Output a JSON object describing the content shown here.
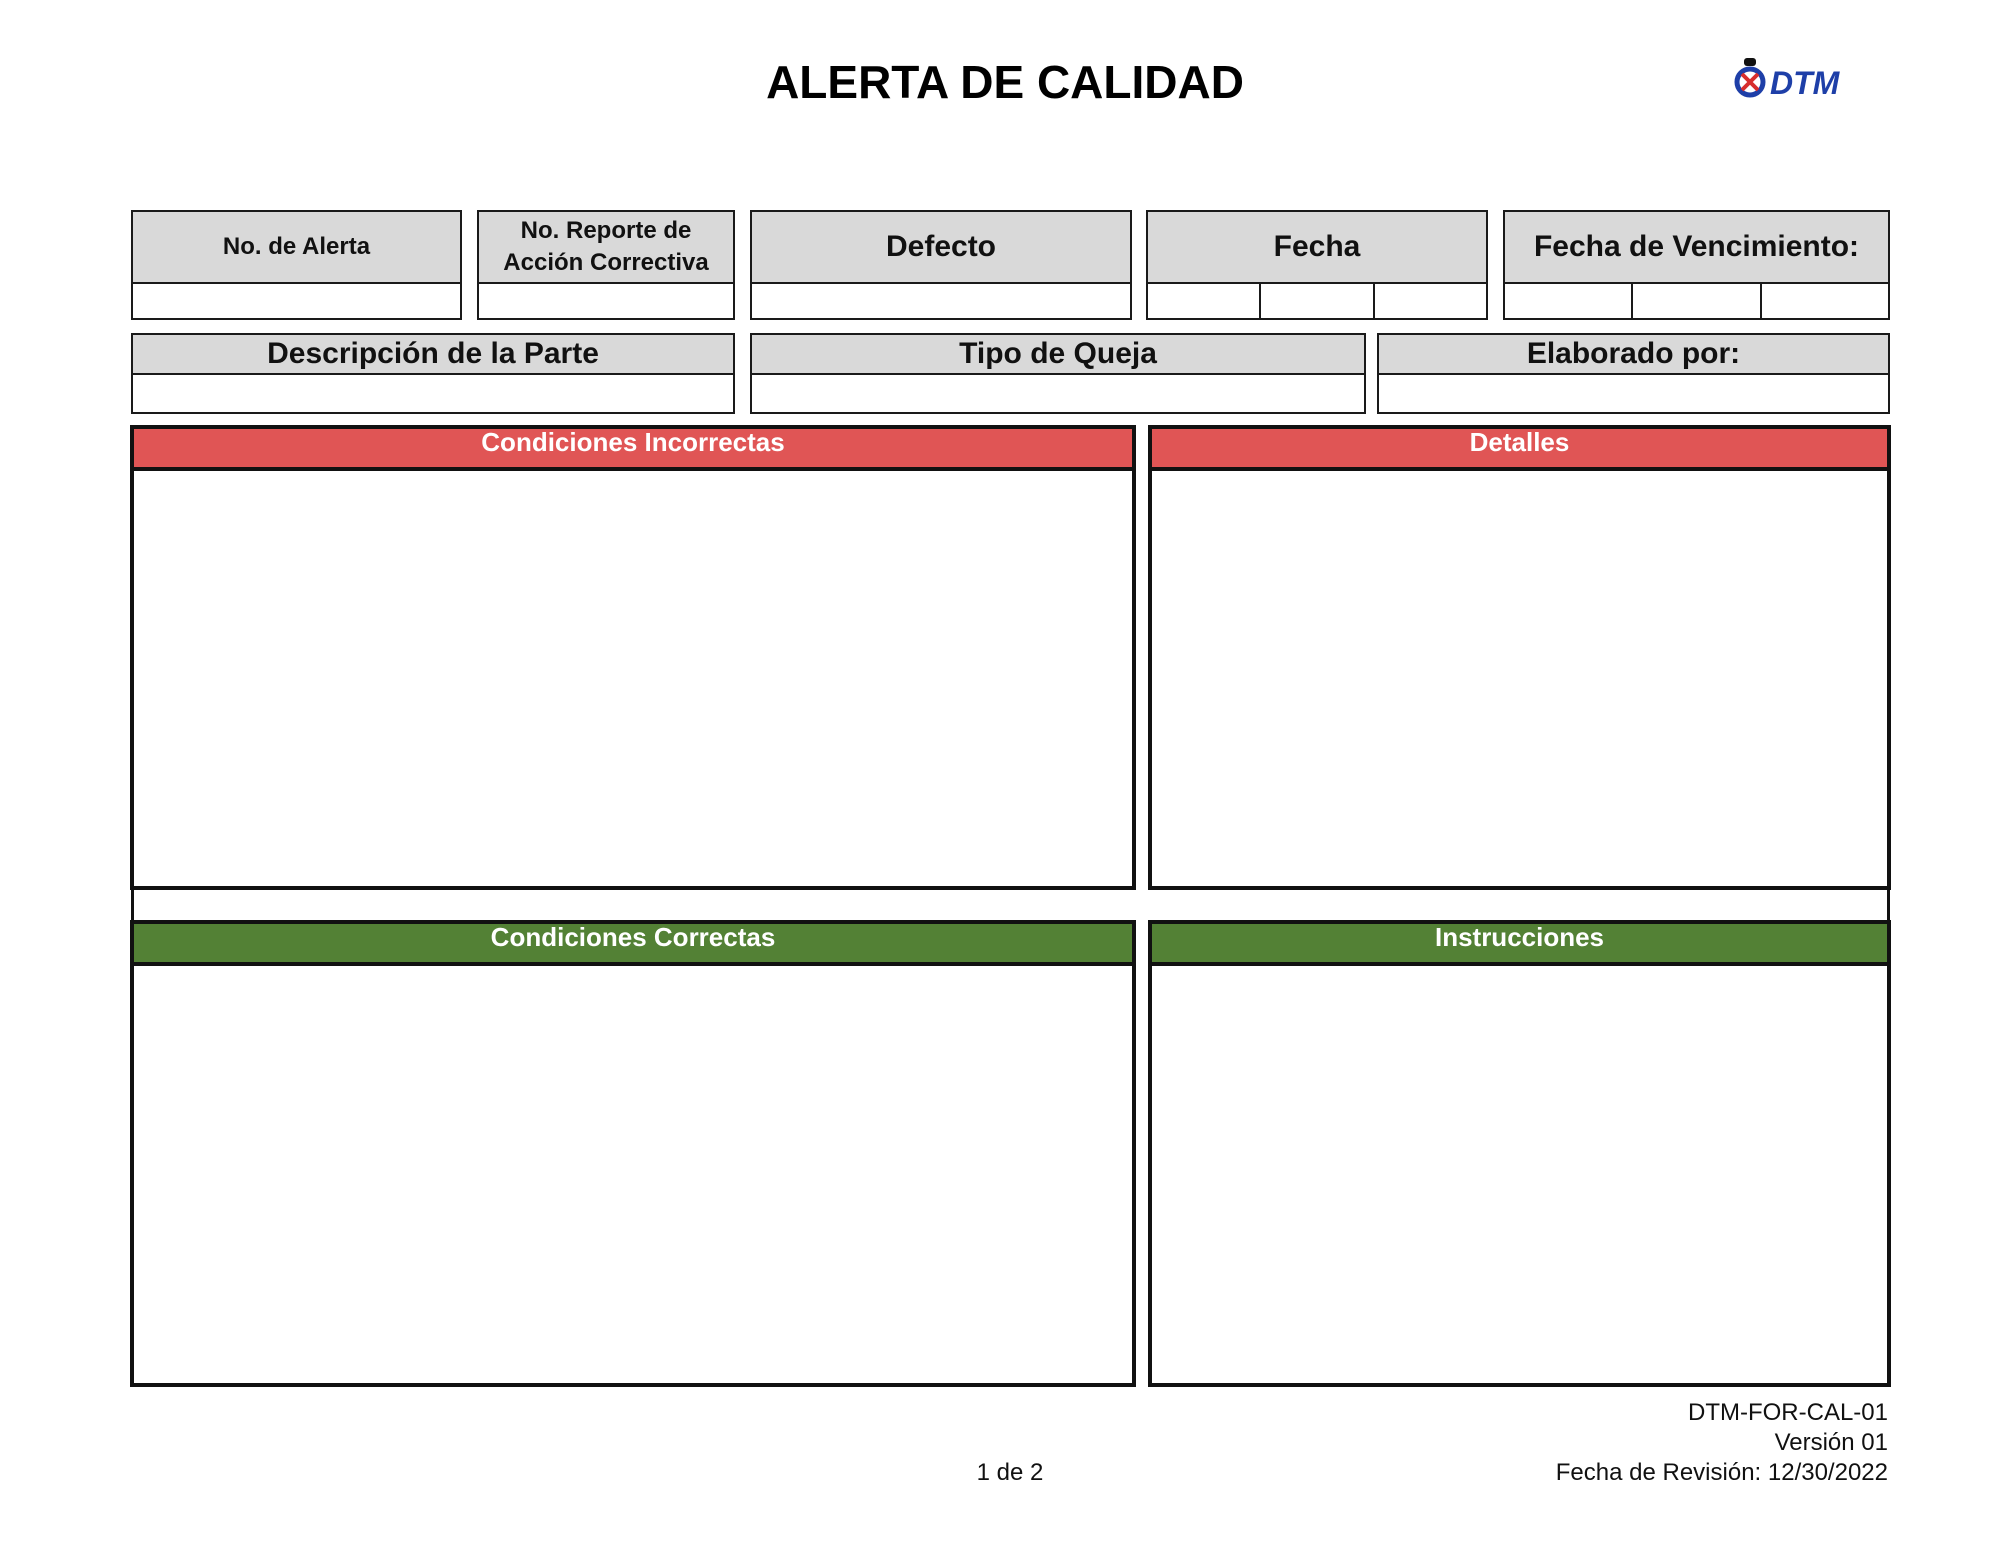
{
  "title": "ALERTA DE CALIDAD",
  "logo": {
    "text": "DTM",
    "colors": {
      "blue": "#1e3fa8",
      "red": "#d62d2d",
      "black": "#111111"
    }
  },
  "header_row1": {
    "alert_no": "No. de Alerta",
    "report_no_line1": "No. Reporte de",
    "report_no_line2": "Acción Correctiva",
    "defect": "Defecto",
    "date": "Fecha",
    "due_date": "Fecha de Vencimiento:"
  },
  "header_row2": {
    "part_description": "Descripción de la Parte",
    "complaint_type": "Tipo de Queja",
    "prepared_by": "Elaborado por:"
  },
  "sections": {
    "incorrect": "Condiciones Incorrectas",
    "details": "Detalles",
    "correct": "Condiciones Correctas",
    "instructions": "Instrucciones"
  },
  "colors": {
    "header_gray": "#d9d9d9",
    "incorrect_red": "#e05555",
    "correct_green": "#538135"
  },
  "footer": {
    "doc_code": "DTM-FOR-CAL-01",
    "version": "Versión 01",
    "revision": "Fecha de Revisión: 12/30/2022",
    "page": "1 de 2"
  }
}
